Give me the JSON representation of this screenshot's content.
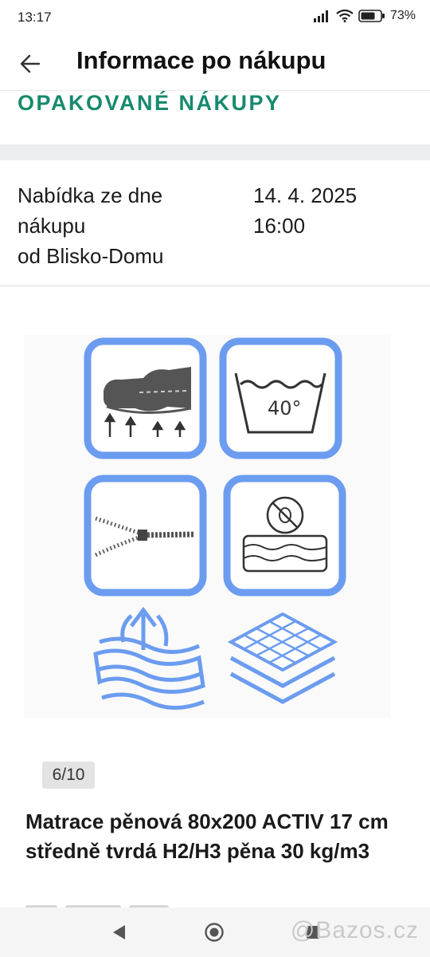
{
  "status": {
    "time": "13:17",
    "battery_percent": "73%",
    "icons": [
      "signal-icon",
      "wifi-icon",
      "battery-icon"
    ]
  },
  "header": {
    "back_icon": "arrow-left-icon",
    "title": "Informace po nákupu"
  },
  "repeat_purchases": {
    "label": "OPAKOVANÉ NÁKUPY",
    "color": "#168a6d"
  },
  "order_info": {
    "left_lines": [
      "Nabídka ze dne",
      "nákupu",
      "od Blisko-Domu"
    ],
    "right_lines": [
      "14. 4. 2025",
      "16:00"
    ]
  },
  "gallery": {
    "counter": "6/10",
    "accent_color": "#6b9cf0"
  },
  "product": {
    "title": "Matrace pěnová 80x200 ACTIV 17 cm středně tvrdá H2/H3 pěna 30 kg/m3"
  },
  "system_nav": {
    "back_icon": "triangle-back-icon",
    "home_icon": "circle-home-icon",
    "recents_icon": "square-recents-icon"
  },
  "watermark": "@Bazos.cz"
}
